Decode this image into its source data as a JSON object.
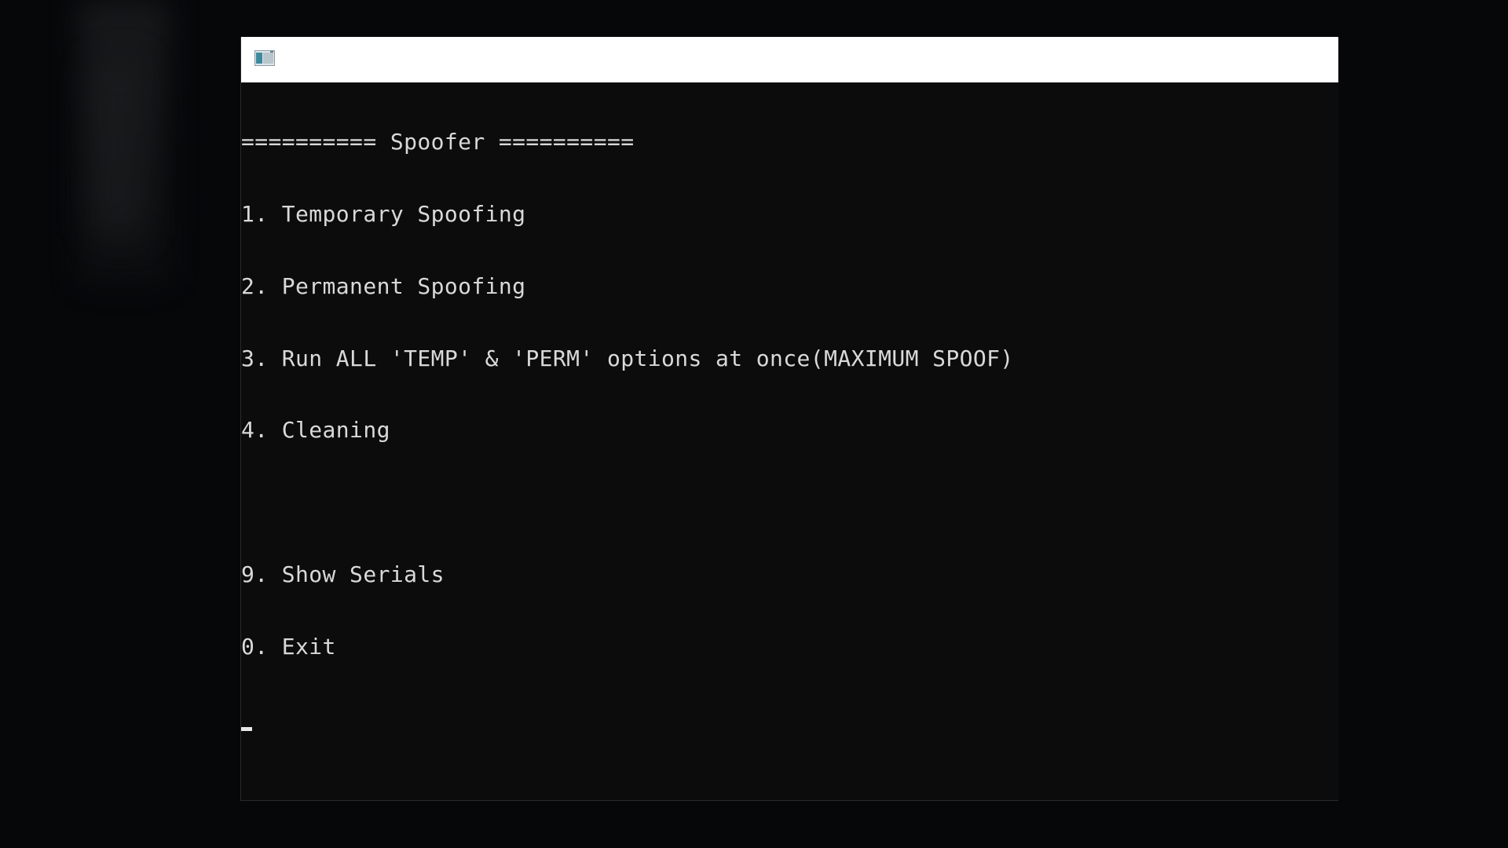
{
  "window": {
    "icon": "console-window-icon",
    "title": ""
  },
  "console": {
    "lines": [
      "========== Spoofer ==========",
      "1. Temporary Spoofing",
      "2. Permanent Spoofing",
      "3. Run ALL 'TEMP' & 'PERM' options at once(MAXIMUM SPOOF)",
      "4. Cleaning",
      "",
      "9. Show Serials",
      "0. Exit"
    ]
  },
  "colors": {
    "console_bg": "#0c0c0c",
    "console_text": "#d9d9d9",
    "title_bar_bg": "#ffffff",
    "desktop_bg": "#060709"
  }
}
